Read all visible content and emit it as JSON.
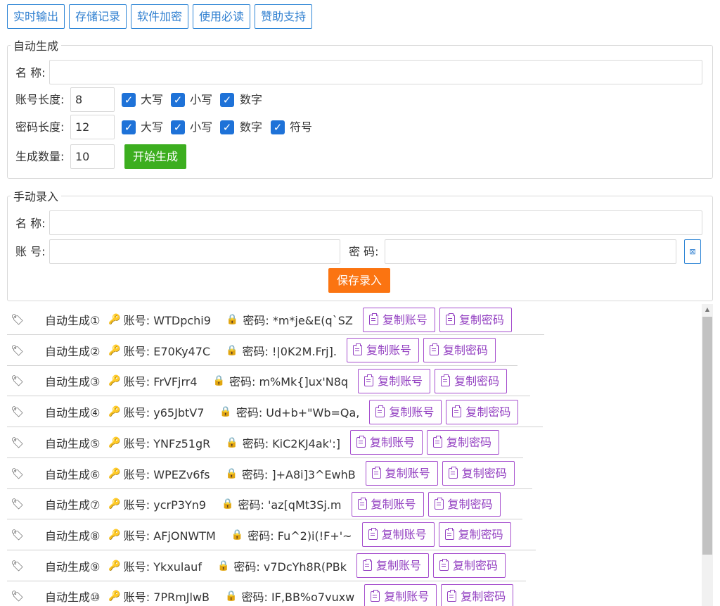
{
  "nav": [
    "实时输出",
    "存储记录",
    "软件加密",
    "使用必读",
    "赞助支持"
  ],
  "auto": {
    "legend": "自动生成",
    "name_label": "名 称:",
    "name_value": "",
    "acc_len_label": "账号长度:",
    "acc_len_value": "8",
    "acc_options": [
      "大写",
      "小写",
      "数字"
    ],
    "pwd_len_label": "密码长度:",
    "pwd_len_value": "12",
    "pwd_options": [
      "大写",
      "小写",
      "数字",
      "符号"
    ],
    "count_label": "生成数量:",
    "count_value": "10",
    "generate_label": "开始生成"
  },
  "manual": {
    "legend": "手动录入",
    "name_label": "名 称:",
    "account_label": "账 号:",
    "password_label": "密 码:",
    "save_label": "保存录入"
  },
  "records": [
    {
      "name": "自动生成①",
      "account": "账号: WTDpchi9",
      "password": "密码: *m*je&E(q`SZ"
    },
    {
      "name": "自动生成②",
      "account": "账号: E70Ky47C",
      "password": "密码: !|0K2M.Frj]."
    },
    {
      "name": "自动生成③",
      "account": "账号: FrVFjrr4",
      "password": "密码: m%Mk{]ux'N8q"
    },
    {
      "name": "自动生成④",
      "account": "账号: y65JbtV7",
      "password": "密码: Ud+b+\"Wb=Qa,"
    },
    {
      "name": "自动生成⑤",
      "account": "账号: YNFz51gR",
      "password": "密码: KiC2KJ4ak':]"
    },
    {
      "name": "自动生成⑥",
      "account": "账号: WPEZv6fs",
      "password": "密码: ]+A8i]3^EwhB"
    },
    {
      "name": "自动生成⑦",
      "account": "账号: ycrP3Yn9",
      "password": "密码: 'az[qMt3Sj.m"
    },
    {
      "name": "自动生成⑧",
      "account": "账号: AFjONWTM",
      "password": "密码: Fu^2)i(!F+'~"
    },
    {
      "name": "自动生成⑨",
      "account": "账号: Ykxulauf",
      "password": "密码: v7DcYh8R(PBk"
    },
    {
      "name": "自动生成⑩",
      "account": "账号: 7PRmJlwB",
      "password": "密码: IF,BB%o7vuxw"
    }
  ],
  "copy_account_label": "复制账号",
  "copy_password_label": "复制密码",
  "colors": {
    "primary": "#2f86d6",
    "green": "#3cae1f",
    "orange": "#fb7411",
    "purple": "#a64fce",
    "checkbox": "#1e72d8"
  }
}
